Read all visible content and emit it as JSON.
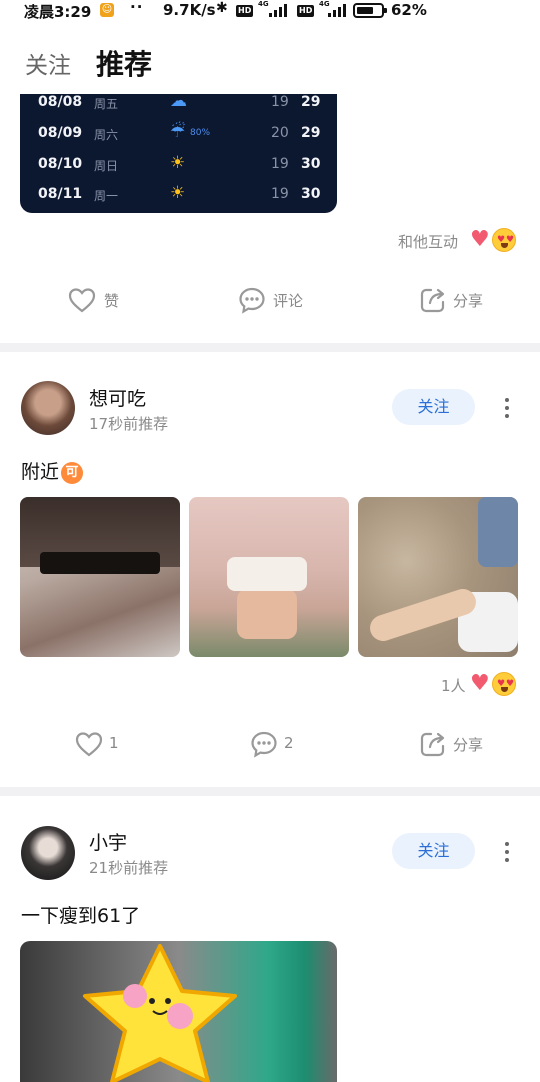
{
  "status_bar": {
    "time": "凌晨3:29",
    "net_speed": "9.7K/s",
    "hd_label": "HD",
    "signal_label": "4G",
    "battery_percent": "62%",
    "battery_level": 0.62
  },
  "tabs": {
    "follow": "关注",
    "recommend": "推荐",
    "active": "推荐"
  },
  "weather_card": {
    "rows": [
      {
        "date": "08/08",
        "weekday": "周五",
        "icon": "partly-cloudy-icon",
        "rain": "",
        "low": "19",
        "high": "29"
      },
      {
        "date": "08/09",
        "weekday": "周六",
        "icon": "rain-cloud-icon",
        "rain": "80%",
        "low": "20",
        "high": "29"
      },
      {
        "date": "08/10",
        "weekday": "周日",
        "icon": "sun-icon",
        "rain": "",
        "low": "19",
        "high": "30"
      },
      {
        "date": "08/11",
        "weekday": "周一",
        "icon": "sun-icon",
        "rain": "",
        "low": "19",
        "high": "30"
      }
    ]
  },
  "post0": {
    "interact_text": "和他互动",
    "actions": {
      "like": "赞",
      "comment": "评论",
      "share": "分享"
    }
  },
  "post1": {
    "username": "想可吃",
    "time": "17秒前推荐",
    "follow": "关注",
    "text": "附近",
    "text_badge": "可",
    "image_count": 3,
    "reaction_count": "1人",
    "actions": {
      "like": "1",
      "comment": "2",
      "share": "分享"
    }
  },
  "post2": {
    "username": "小宇",
    "time": "21秒前推荐",
    "follow": "关注",
    "text": "一下瘦到61了"
  },
  "colors": {
    "accent": "#2b6fd6",
    "follow_bg": "#eaf2fd",
    "weather_bg": "#0c1730",
    "divider": "#f1f1f3"
  }
}
